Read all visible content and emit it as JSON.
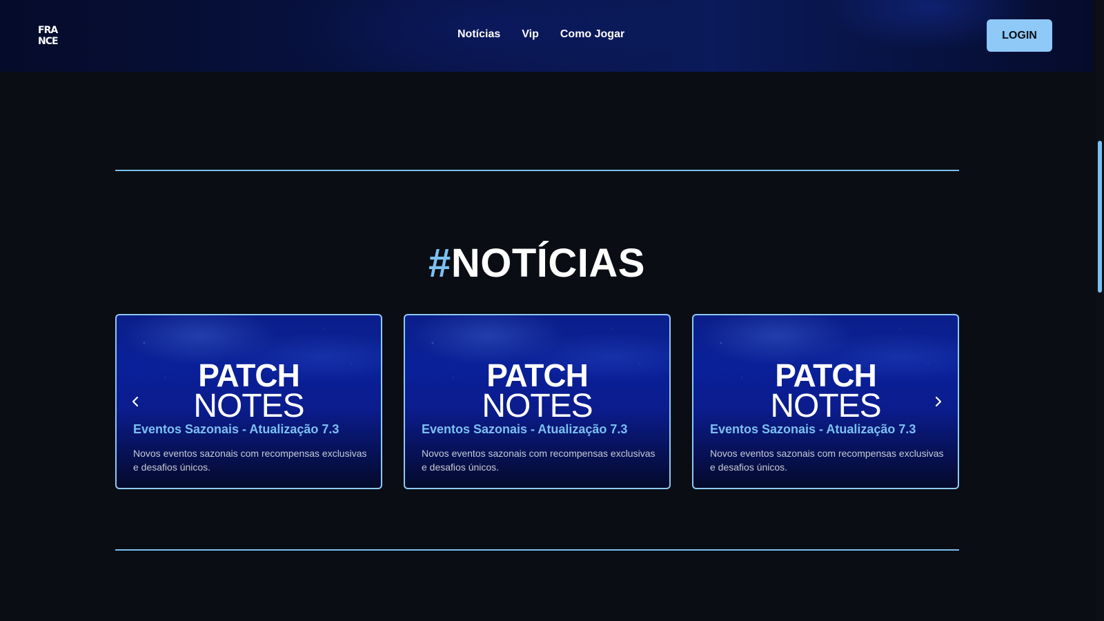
{
  "header": {
    "logo_line1": "FRA",
    "logo_line2": "NCE",
    "nav": [
      {
        "label": "Notícias"
      },
      {
        "label": "Vip"
      },
      {
        "label": "Como Jogar"
      }
    ],
    "login_label": "LOGIN"
  },
  "section": {
    "hash": "#",
    "title": "NOTÍCIAS"
  },
  "cards": [
    {
      "image_title_1": "PATCH",
      "image_title_2": "NOTES",
      "title": "Eventos Sazonais - Atualização 7.3",
      "description": "Novos eventos sazonais com recompensas exclusivas e desafios únicos."
    },
    {
      "image_title_1": "PATCH",
      "image_title_2": "NOTES",
      "title": "Eventos Sazonais - Atualização 7.3",
      "description": "Novos eventos sazonais com recompensas exclusivas e desafios únicos."
    },
    {
      "image_title_1": "PATCH",
      "image_title_2": "NOTES",
      "title": "Eventos Sazonais - Atualização 7.3",
      "description": "Novos eventos sazonais com recompensas exclusivas e desafios únicos."
    }
  ],
  "carousel": {
    "prev_icon": "chevron-left-icon",
    "next_icon": "chevron-right-icon"
  },
  "colors": {
    "accent": "#7cc0f2",
    "login_bg": "#8ec9f7",
    "page_bg": "#0a0e14"
  }
}
